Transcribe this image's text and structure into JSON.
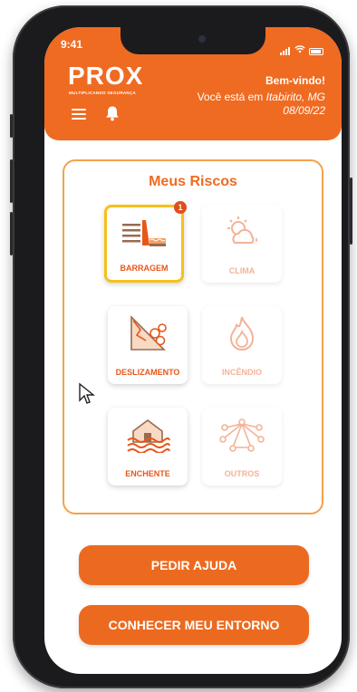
{
  "status_bar": {
    "time": "9:41"
  },
  "header": {
    "logo_text": "PROX",
    "logo_tagline": "MULTIPLICANDO SEGURANÇA",
    "welcome": "Bem-vindo!",
    "location_prefix": "Você está em ",
    "location_city": "Itabirito, MG",
    "date": "08/09/22",
    "menu_icon": "menu-icon",
    "bell_icon": "bell-icon"
  },
  "risks": {
    "title": "Meus Riscos",
    "items": [
      {
        "label": "BARRAGEM",
        "icon": "dam-icon",
        "badge": "1",
        "state": "active"
      },
      {
        "label": "CLIMA",
        "icon": "weather-icon",
        "state": "disabled"
      },
      {
        "label": "DESLIZAMENTO",
        "icon": "landslide-icon",
        "state": "enabled"
      },
      {
        "label": "INCÊNDIO",
        "icon": "fire-icon",
        "state": "disabled"
      },
      {
        "label": "ENCHENTE",
        "icon": "flood-icon",
        "state": "enabled"
      },
      {
        "label": "OUTROS",
        "icon": "network-icon",
        "state": "disabled"
      }
    ]
  },
  "actions": {
    "help": "PEDIR AJUDA",
    "surroundings": "CONHECER MEU ENTORNO"
  },
  "colors": {
    "primary": "#ef6b21",
    "highlight": "#f5c11b",
    "card_border": "#f3a24c"
  }
}
